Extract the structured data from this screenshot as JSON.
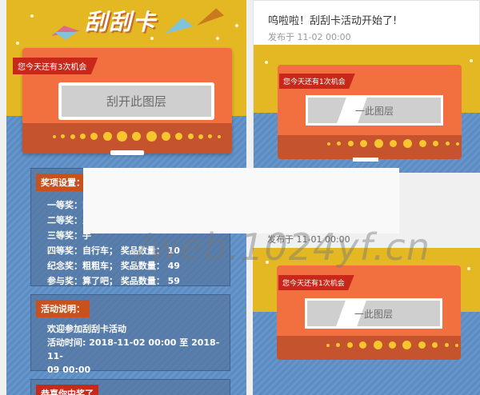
{
  "left": {
    "title": "刮刮卡",
    "chance_label": "您今天还有3次机会",
    "scratch_label": "刮开此图层",
    "prize_section": {
      "header": "奖项设置：",
      "rows": [
        "一等奖：田",
        "二等奖：火",
        "三等奖：手",
        "四等奖：自行车；   奖品数量：  10",
        "纪念奖：粗粗车；   奖品数量：  49",
        "参与奖：算了吧；   奖品数量：  59"
      ]
    },
    "desc_section": {
      "header": "活动说明：",
      "line1": "欢迎参加刮刮卡活动",
      "line2": "活动时间: 2018-11-02 00:00 至 2018-11-",
      "line3": "09 00:00"
    },
    "winner_section": {
      "header": "恭喜你中奖了"
    }
  },
  "right": {
    "post_title": "呜啦啦！刮刮卡活动开始了!",
    "post_date": "发布于 11-02 00:00",
    "mini1": {
      "chance_label": "您今天还有1次机会",
      "scratch_label": "一此图层"
    },
    "date2": "发布于 11-01 00:00",
    "mini2": {
      "chance_label": "您今天还有1次机会",
      "scratch_label": "一此图层"
    }
  },
  "watermark": "/web.1024yf.cn",
  "colors": {
    "yellow": "#e3b823",
    "orange": "#f26f3f",
    "red": "#c8281a",
    "blue": "#5d8ec4",
    "dot": "#f7c62f"
  }
}
